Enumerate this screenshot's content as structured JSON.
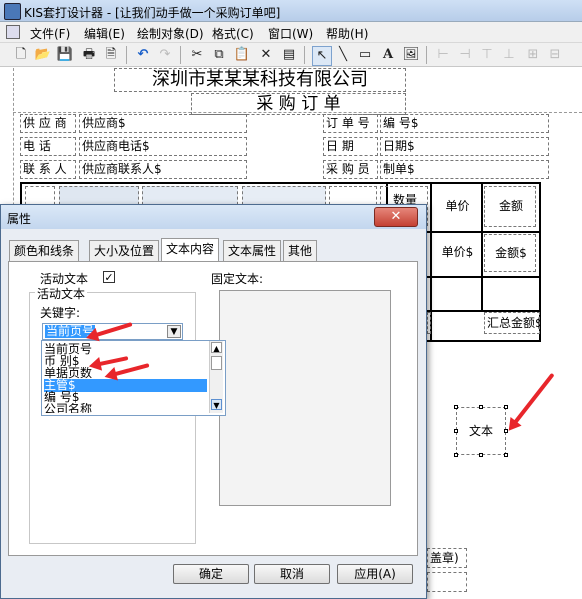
{
  "window": {
    "title": "KIS套打设计器 - [让我们动手做一个采购订单吧]"
  },
  "menu": [
    "文件(F)",
    "编辑(E)",
    "绘制对象(D)",
    "格式(C)",
    "窗口(W)",
    "帮助(H)"
  ],
  "toolbar": {
    "icons": [
      "new-file-icon",
      "open-folder-icon",
      "save-icon",
      "print-icon",
      "print-preview-icon",
      "undo-icon",
      "redo-icon",
      "cut-icon",
      "copy-icon",
      "paste-icon",
      "delete-icon",
      "properties-icon",
      "pointer-icon",
      "line-tool-icon",
      "rect-tool-icon",
      "text-tool-icon",
      "image-tool-icon",
      "align-left-icon",
      "align-right-icon",
      "align-top-icon",
      "align-bottom-icon",
      "center-icon"
    ]
  },
  "report": {
    "company": "深圳市某某某科技有限公司",
    "doc_title": "采 购 订 单",
    "labels": {
      "supplier": "供 应 商",
      "phone": "电    话",
      "contact": "联 系 人",
      "order_no": "订 单 号",
      "date": "日    期",
      "buyer": "采 购 员"
    },
    "fields": {
      "supplier": "供应商$",
      "phone": "供应商电话$",
      "contact": "供应商联系人$",
      "order_no": "编      号$",
      "date": "日期$",
      "buyer": "制单$"
    },
    "table": {
      "price_header": "单价",
      "amount_header": "金额",
      "price_field": "单价$",
      "amount_field": "金额$",
      "total_field": "汇总金额$",
      "qty_header_partial": "数量"
    },
    "footer_partial": "盖章)",
    "text_object": "文本"
  },
  "dialog": {
    "title": "属性",
    "close": "✕",
    "tabs": [
      "颜色和线条",
      "大小及位置",
      "文本内容",
      "文本属性",
      "其他"
    ],
    "active_tab": "文本内容",
    "active_text_label": "活动文本",
    "active_text_checked": "✓",
    "group_label": "活动文本",
    "keyword_label": "关键字:",
    "keyword_value": "当前页号",
    "fixed_text_label": "固定文本:",
    "list_items": [
      "当前页号",
      "币      别$",
      "单据页数",
      "主管$",
      "编      号$",
      "公司名称"
    ],
    "selected_item": "主管$",
    "buttons": {
      "ok": "确定",
      "cancel": "取消",
      "apply": "应用(A)"
    }
  },
  "colors": {
    "annotation_arrow": "#e8262b",
    "selection": "#3399ff"
  }
}
